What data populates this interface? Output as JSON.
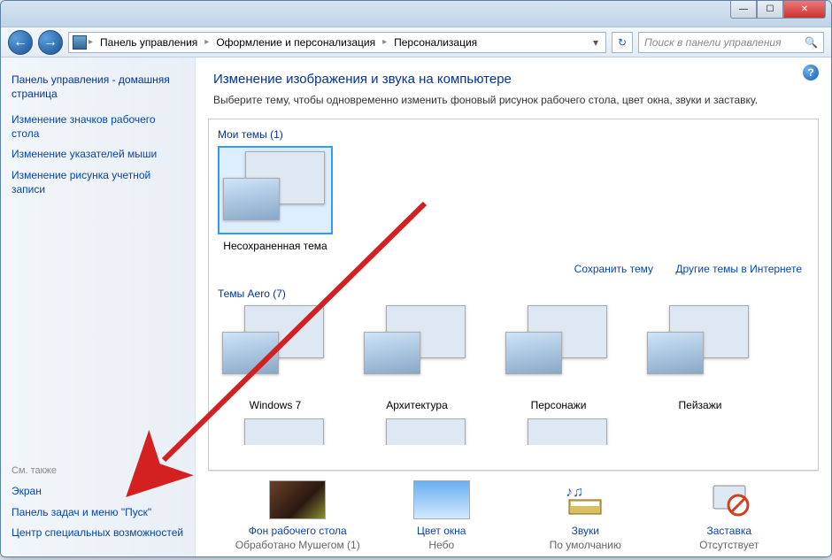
{
  "titlebar": {
    "min": "—",
    "max": "☐",
    "close": "✕"
  },
  "nav": {
    "back": "←",
    "fwd": "→"
  },
  "breadcrumb": {
    "items": [
      "Панель управления",
      "Оформление и персонализация",
      "Персонализация"
    ]
  },
  "search": {
    "placeholder": "Поиск в панели управления"
  },
  "sidebar": {
    "home": "Панель управления - домашняя страница",
    "links": [
      "Изменение значков рабочего стола",
      "Изменение указателей мыши",
      "Изменение рисунка учетной записи"
    ],
    "see_also_header": "См. также",
    "see_also": [
      "Экран",
      "Панель задач и меню \"Пуск\"",
      "Центр специальных возможностей"
    ]
  },
  "main": {
    "heading": "Изменение изображения и звука на компьютере",
    "subtext": "Выберите тему, чтобы одновременно изменить фоновый рисунок рабочего стола, цвет окна, звуки и заставку.",
    "my_themes_label": "Мои темы (1)",
    "my_themes": [
      {
        "name": "Несохраненная тема"
      }
    ],
    "actions": {
      "save": "Сохранить тему",
      "online": "Другие темы в Интернете"
    },
    "aero_label": "Темы Aero (7)",
    "aero": [
      {
        "name": "Windows 7"
      },
      {
        "name": "Архитектура"
      },
      {
        "name": "Персонажи"
      },
      {
        "name": "Пейзажи"
      }
    ]
  },
  "bottom": {
    "items": [
      {
        "label": "Фон рабочего стола",
        "sub": "Обработано Мушегом (1)"
      },
      {
        "label": "Цвет окна",
        "sub": "Небо"
      },
      {
        "label": "Звуки",
        "sub": "По умолчанию"
      },
      {
        "label": "Заставка",
        "sub": "Отсутствует"
      }
    ]
  }
}
